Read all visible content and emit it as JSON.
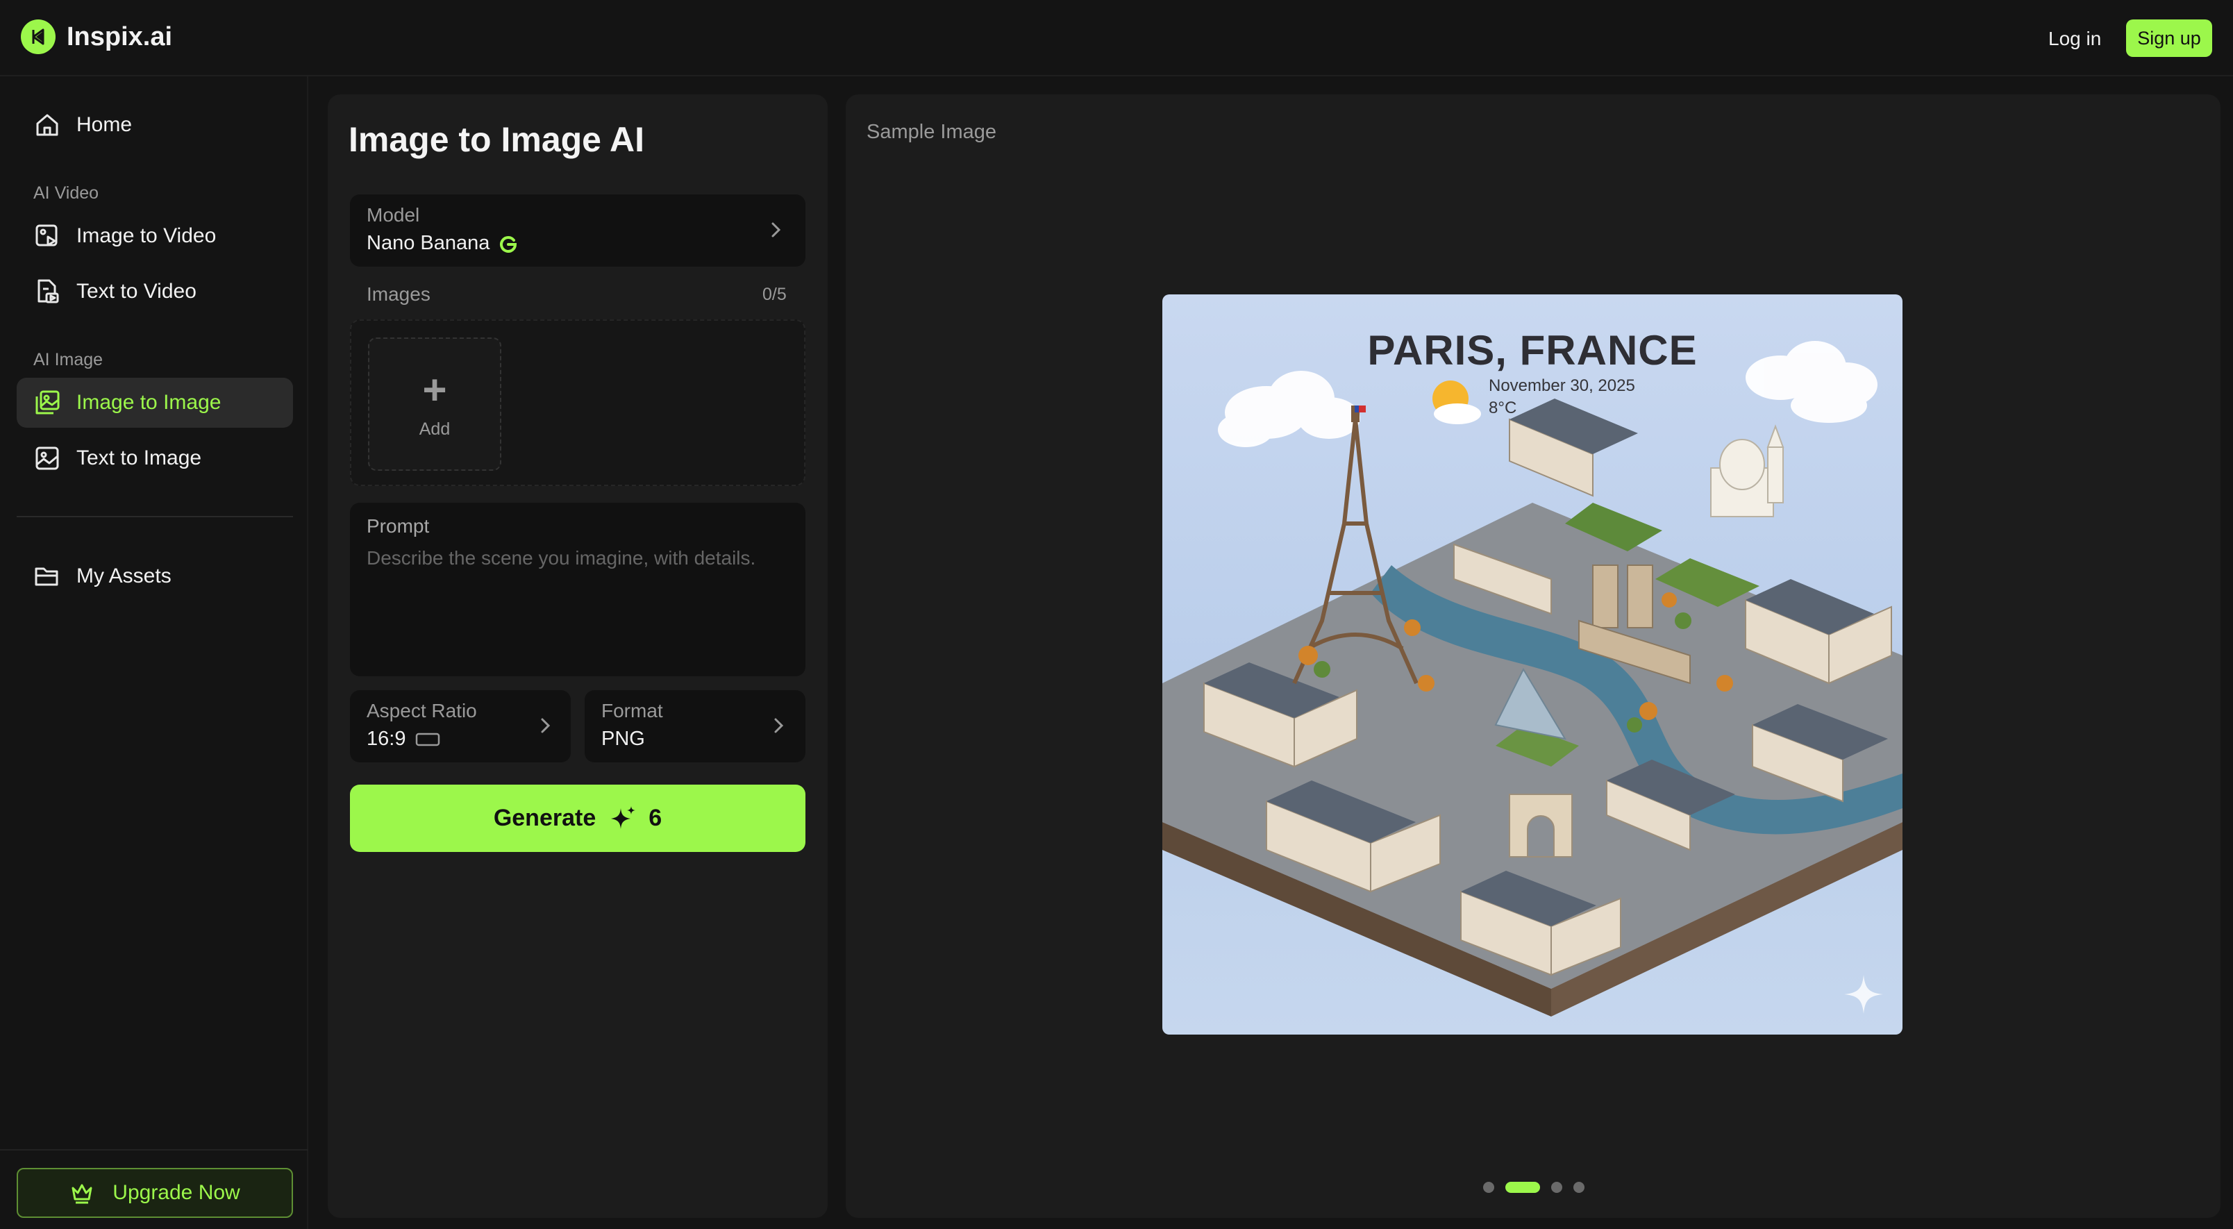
{
  "app": {
    "name": "Inspix.ai",
    "login_label": "Log in",
    "signup_label": "Sign up"
  },
  "sidebar": {
    "home_label": "Home",
    "sections": [
      {
        "label": "AI Video",
        "items": [
          {
            "label": "Image to Video",
            "icon": "image-video-icon"
          },
          {
            "label": "Text to Video",
            "icon": "text-video-icon"
          }
        ]
      },
      {
        "label": "AI Image",
        "items": [
          {
            "label": "Image to Image",
            "icon": "image-image-icon",
            "active": true
          },
          {
            "label": "Text to Image",
            "icon": "image-icon"
          }
        ]
      }
    ],
    "assets_label": "My Assets",
    "upgrade_label": "Upgrade Now"
  },
  "panel": {
    "title": "Image to Image AI",
    "model": {
      "label": "Model",
      "value": "Nano Banana"
    },
    "images": {
      "label": "Images",
      "count": "0/5",
      "add_label": "Add"
    },
    "prompt": {
      "label": "Prompt",
      "placeholder": "Describe the scene you imagine, with details.",
      "value": ""
    },
    "aspect_ratio": {
      "label": "Aspect Ratio",
      "value": "16:9"
    },
    "format": {
      "label": "Format",
      "value": "PNG"
    },
    "generate": {
      "label": "Generate",
      "cost": "6"
    }
  },
  "preview": {
    "title": "Sample Image",
    "image": {
      "headline": "PARIS, FRANCE",
      "date": "November 30, 2025",
      "temperature": "8°C"
    },
    "carousel": {
      "total": 4,
      "active_index": 1
    }
  },
  "colors": {
    "accent": "#9cf74b",
    "background": "#141414",
    "panel": "#1c1c1c",
    "field": "#111111"
  }
}
